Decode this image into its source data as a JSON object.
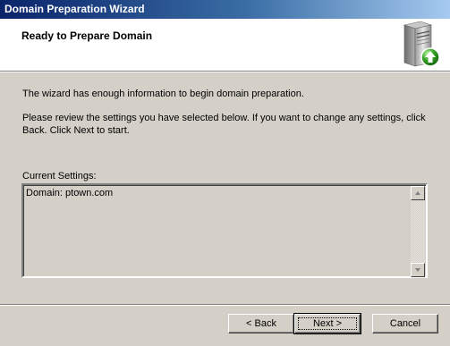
{
  "window": {
    "title": "Domain Preparation Wizard"
  },
  "header": {
    "heading": "Ready to Prepare Domain",
    "icon": "server-upgrade-icon"
  },
  "body": {
    "intro": "The wizard has enough information to begin domain preparation.",
    "instructions": "Please review the settings you have selected below. If you want to change any settings, click Back. Click Next to start.",
    "settings_label": "Current Settings:",
    "settings_text": "Domain: ptown.com"
  },
  "buttons": {
    "back": "< Back",
    "next": "Next >",
    "cancel": "Cancel"
  },
  "colors": {
    "titlebar_start": "#0a246a",
    "titlebar_end": "#a6caf0",
    "dialog_bg": "#d4d0c8"
  }
}
